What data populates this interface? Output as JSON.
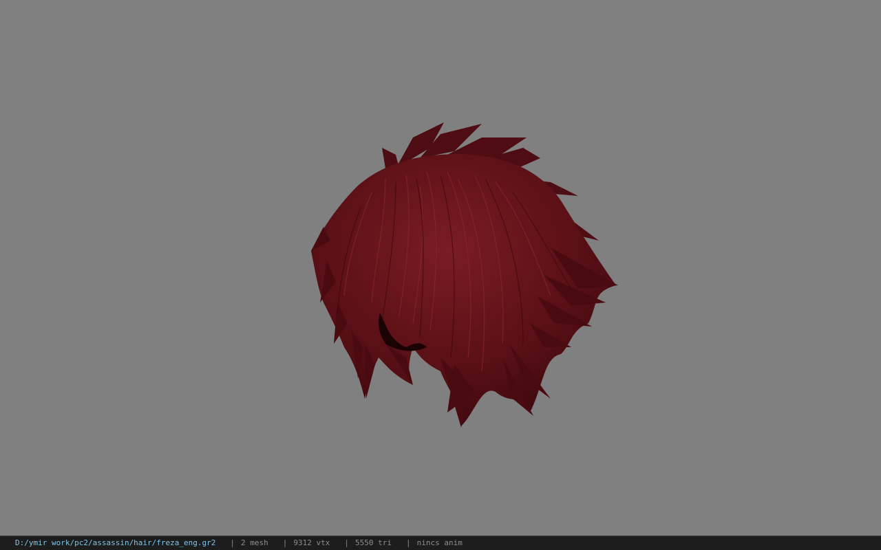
{
  "viewport": {
    "background": "#808080",
    "model": {
      "name": "hair-mesh",
      "color_base": "#5a1016",
      "color_highlight": "#7a1c24",
      "color_shadow": "#2a0508"
    }
  },
  "statusbar": {
    "path": "D:/ymir work/pc2/assassin/hair/freza_eng.gr2",
    "separator": "|",
    "mesh": "2 mesh",
    "vtx": "9312 vtx",
    "tri": "5550 tri",
    "anim": "nincs anim"
  }
}
